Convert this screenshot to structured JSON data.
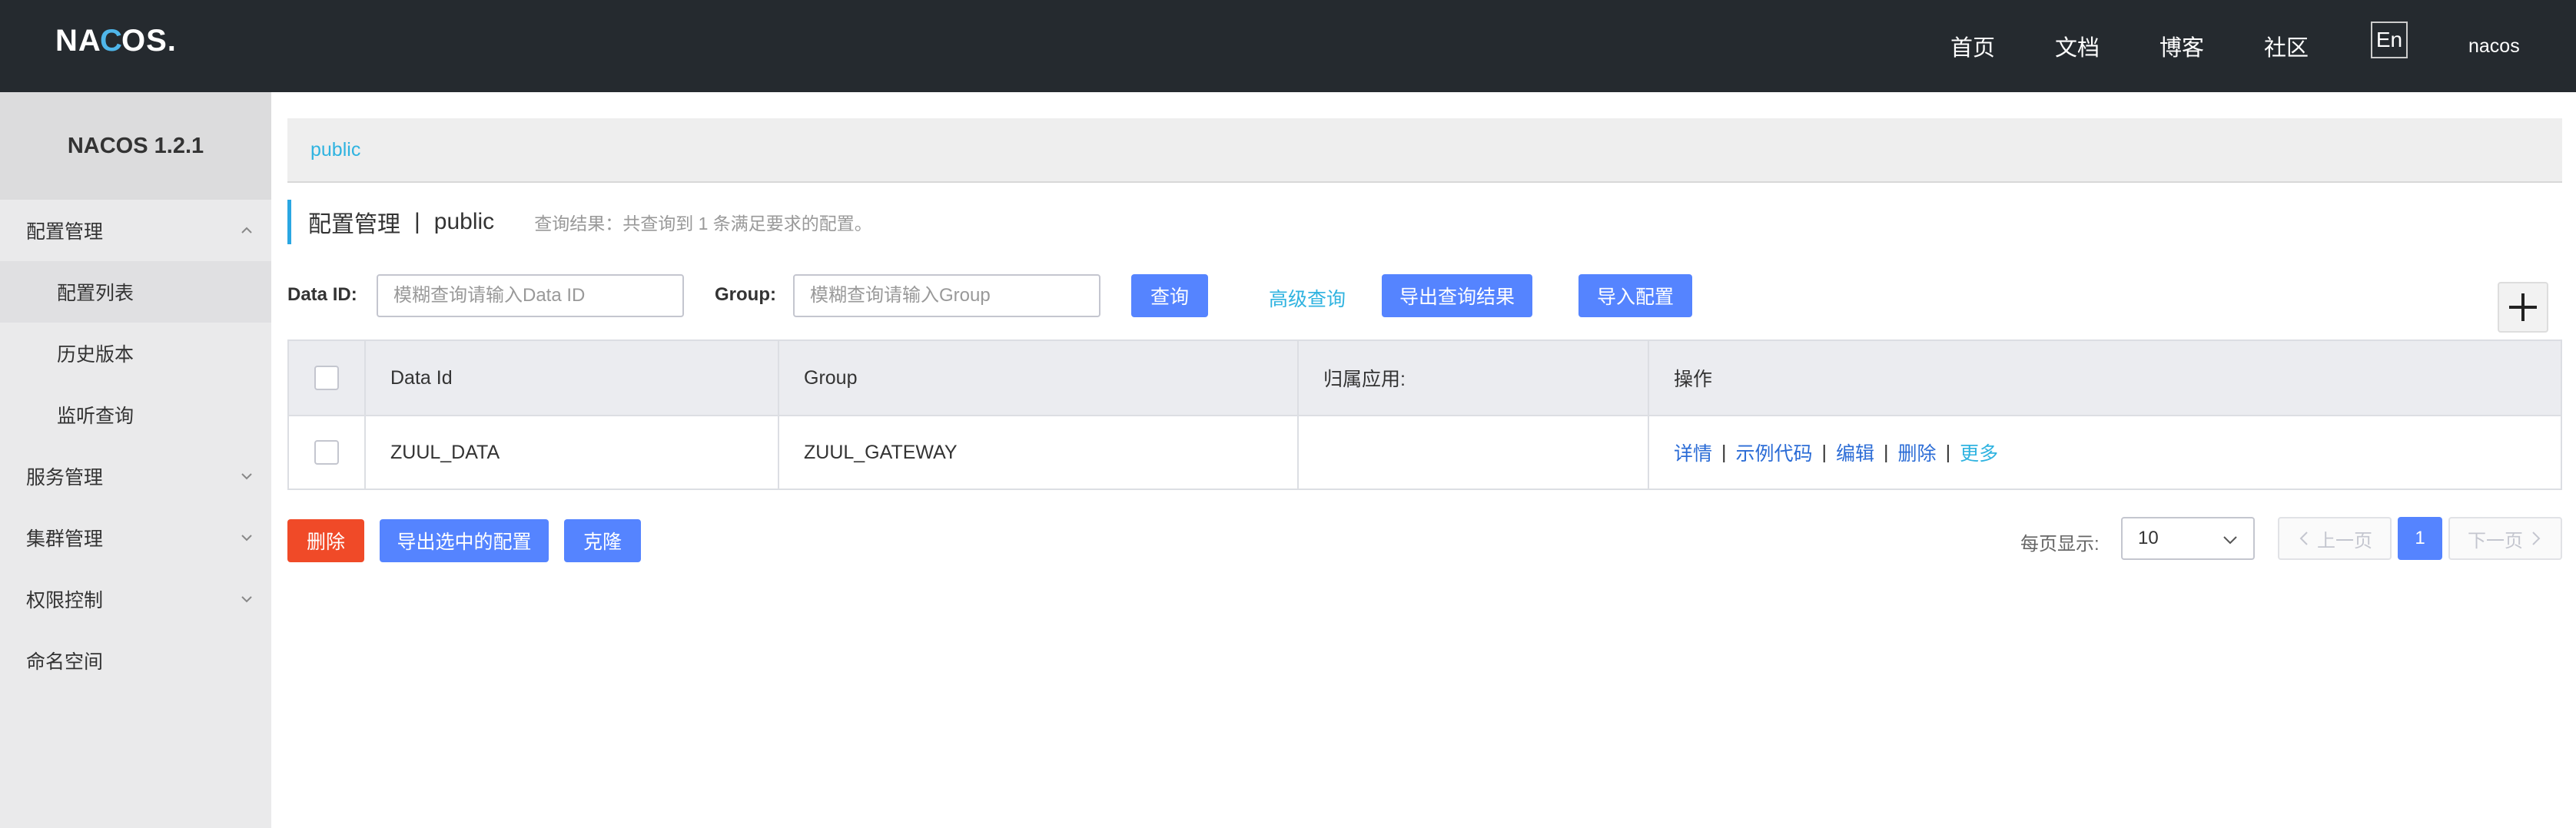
{
  "header": {
    "logo": "NACOS.",
    "nav": [
      "首页",
      "文档",
      "博客",
      "社区"
    ],
    "lang": "En",
    "user": "nacos"
  },
  "sidebar": {
    "title": "NACOS 1.2.1",
    "items": [
      {
        "label": "配置管理",
        "expanded": true
      },
      {
        "label": "配置列表",
        "active": true
      },
      {
        "label": "历史版本"
      },
      {
        "label": "监听查询"
      },
      {
        "label": "服务管理"
      },
      {
        "label": "集群管理"
      },
      {
        "label": "权限控制"
      },
      {
        "label": "命名空间"
      }
    ]
  },
  "main": {
    "namespace_tab": "public",
    "page_title": "配置管理",
    "separator": "|",
    "namespace": "public",
    "query_result": "查询结果：共查询到 1 条满足要求的配置。",
    "filters": {
      "data_id_label": "Data ID:",
      "data_id_placeholder": "模糊查询请输入Data ID",
      "group_label": "Group:",
      "group_placeholder": "模糊查询请输入Group",
      "query_button": "查询",
      "advanced_query": "高级查询",
      "export_results": "导出查询结果",
      "import_config": "导入配置"
    },
    "table": {
      "headers": [
        "Data Id",
        "Group",
        "归属应用:",
        "操作"
      ],
      "rows": [
        {
          "data_id": "ZUUL_DATA",
          "group": "ZUUL_GATEWAY",
          "app": ""
        }
      ],
      "actions": [
        "详情",
        "示例代码",
        "编辑",
        "删除",
        "更多"
      ]
    },
    "bottom": {
      "delete": "删除",
      "export_selected": "导出选中的配置",
      "clone": "克隆"
    },
    "pagination": {
      "page_size_label": "每页显示:",
      "page_size": "10",
      "prev": "上一页",
      "current": "1",
      "next": "下一页"
    }
  },
  "colors": {
    "topbar": "#252a2f",
    "primary": "#5584ff",
    "danger": "#f04a28",
    "link": "#2fb3e0"
  }
}
